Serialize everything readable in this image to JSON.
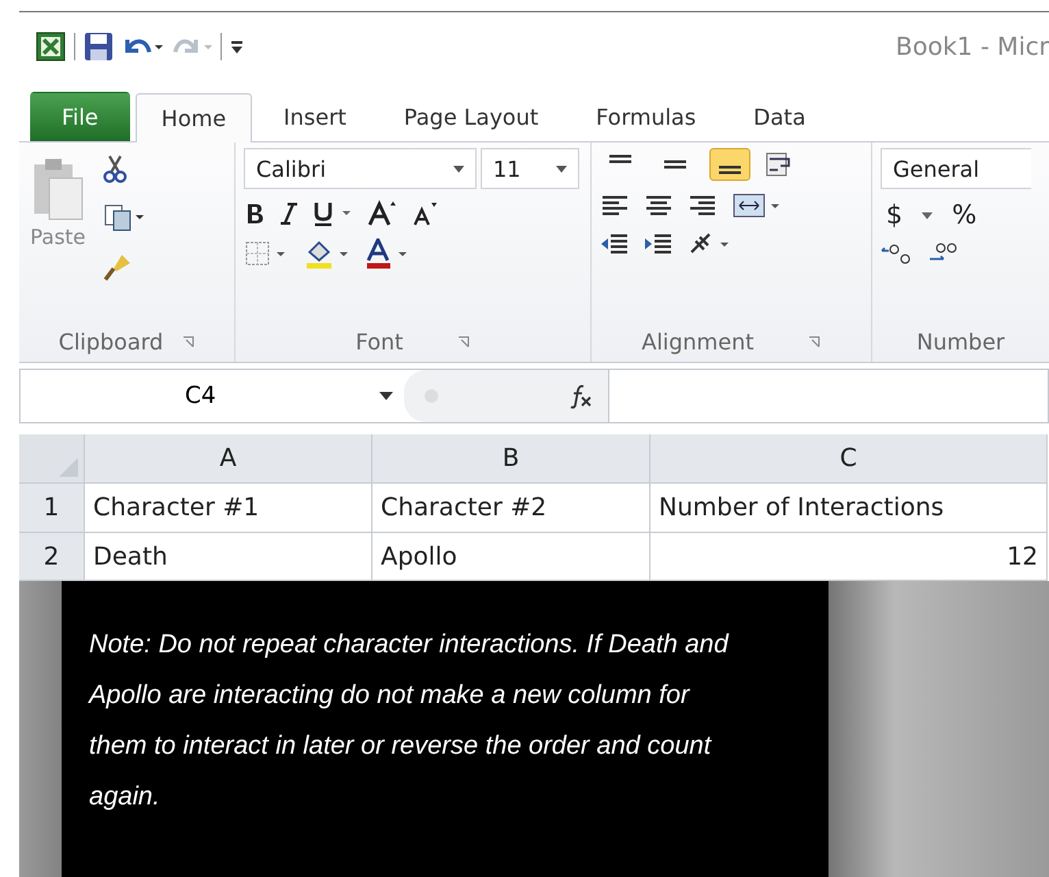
{
  "title_bar": {
    "title": "Book1 - Micr"
  },
  "tabs": [
    {
      "label": "File",
      "kind": "file",
      "selected": false
    },
    {
      "label": "Home",
      "kind": "tab",
      "selected": true
    },
    {
      "label": "Insert",
      "kind": "tab",
      "selected": false
    },
    {
      "label": "Page Layout",
      "kind": "tab",
      "selected": false
    },
    {
      "label": "Formulas",
      "kind": "tab",
      "selected": false
    },
    {
      "label": "Data",
      "kind": "tab",
      "selected": false
    }
  ],
  "ribbon": {
    "clipboard": {
      "paste_label": "Paste",
      "group_label": "Clipboard"
    },
    "font": {
      "font_name": "Calibri",
      "font_size": "11",
      "group_label": "Font"
    },
    "alignment": {
      "vertical_align": [
        {
          "selected": false
        },
        {
          "selected": false
        },
        {
          "selected": true
        }
      ],
      "group_label": "Alignment"
    },
    "number": {
      "format": "General",
      "currency": "$",
      "percent": "%",
      "group_label": "Number"
    }
  },
  "formula_bar": {
    "name_box": "C4"
  },
  "sheet": {
    "columns": [
      "A",
      "B",
      "C"
    ],
    "rows": [
      {
        "number": "1",
        "cells": [
          {
            "text": "Character #1",
            "kind": "text"
          },
          {
            "text": "Character #2",
            "kind": "text"
          },
          {
            "text": "Number of Interactions",
            "kind": "text"
          }
        ]
      },
      {
        "number": "2",
        "cells": [
          {
            "text": "Death",
            "kind": "text"
          },
          {
            "text": "Apollo",
            "kind": "text"
          },
          {
            "text": "12",
            "kind": "number"
          }
        ]
      }
    ]
  },
  "note": {
    "text": "Note: Do not repeat character interactions. If Death and Apollo are interacting do not make a new column for them to interact in later or reverse the order and count again."
  }
}
